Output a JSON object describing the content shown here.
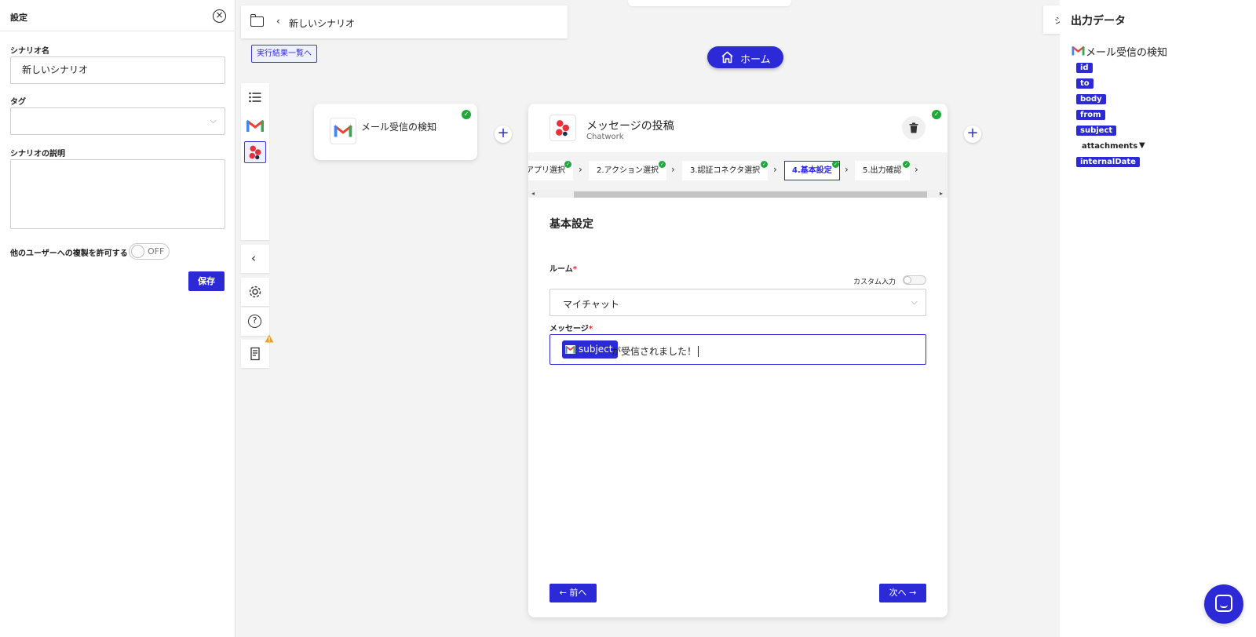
{
  "left_panel": {
    "title": "設定",
    "scenario_name_label": "シナリオ名",
    "scenario_name_value": "新しいシナリオ",
    "tag_label": "タグ",
    "description_label": "シナリオの説明",
    "copy_permission_label": "他のユーザーへの複製を許可する",
    "copy_toggle_state": "OFF",
    "save_label": "保存"
  },
  "header": {
    "back_glyph": "‹",
    "scenario_title": "新しいシナリオ",
    "results_link": "実行結果一覧へ",
    "home_label": "ホーム"
  },
  "trigger_card": {
    "title": "メール受信の検知"
  },
  "action_card": {
    "title": "メッセージの投稿",
    "subtitle": "Chatwork",
    "steps": [
      {
        "label": "アプリ選択",
        "active": false
      },
      {
        "label": "2.アクション選択",
        "active": false
      },
      {
        "label": "3.認証コネクタ選択",
        "active": false
      },
      {
        "label": "4.基本設定",
        "active": true
      },
      {
        "label": "5.出力確認",
        "active": false
      }
    ],
    "section_title": "基本設定",
    "room_label": "ルーム",
    "required_mark": "*",
    "custom_input_label": "カスタム入力",
    "room_value": "マイチャット",
    "message_label": "メッセージ",
    "message_chip": "subject",
    "message_text": "が受信されました！",
    "prev_label": "← 前へ",
    "next_label": "次へ →"
  },
  "output_panel": {
    "stub_text": "シ",
    "title": "出力データ",
    "source_title": "メール受信の検知",
    "fields": [
      "id",
      "to",
      "body",
      "from",
      "subject"
    ],
    "attachments_label": "attachments",
    "attachments_caret": "▼",
    "last_field": "internalDate"
  },
  "colors": {
    "accent": "#2b2ad6",
    "success": "#1fa93a",
    "gmail_red": "#ea4335",
    "chatwork_red": "#e8303b"
  },
  "icons": {
    "close": "close-icon",
    "folder": "folder-icon",
    "home": "home-icon",
    "list": "list-icon",
    "gear": "gear-icon",
    "help": "help-icon",
    "log": "log-icon",
    "warning": "warning-icon",
    "trash": "trash-icon"
  }
}
